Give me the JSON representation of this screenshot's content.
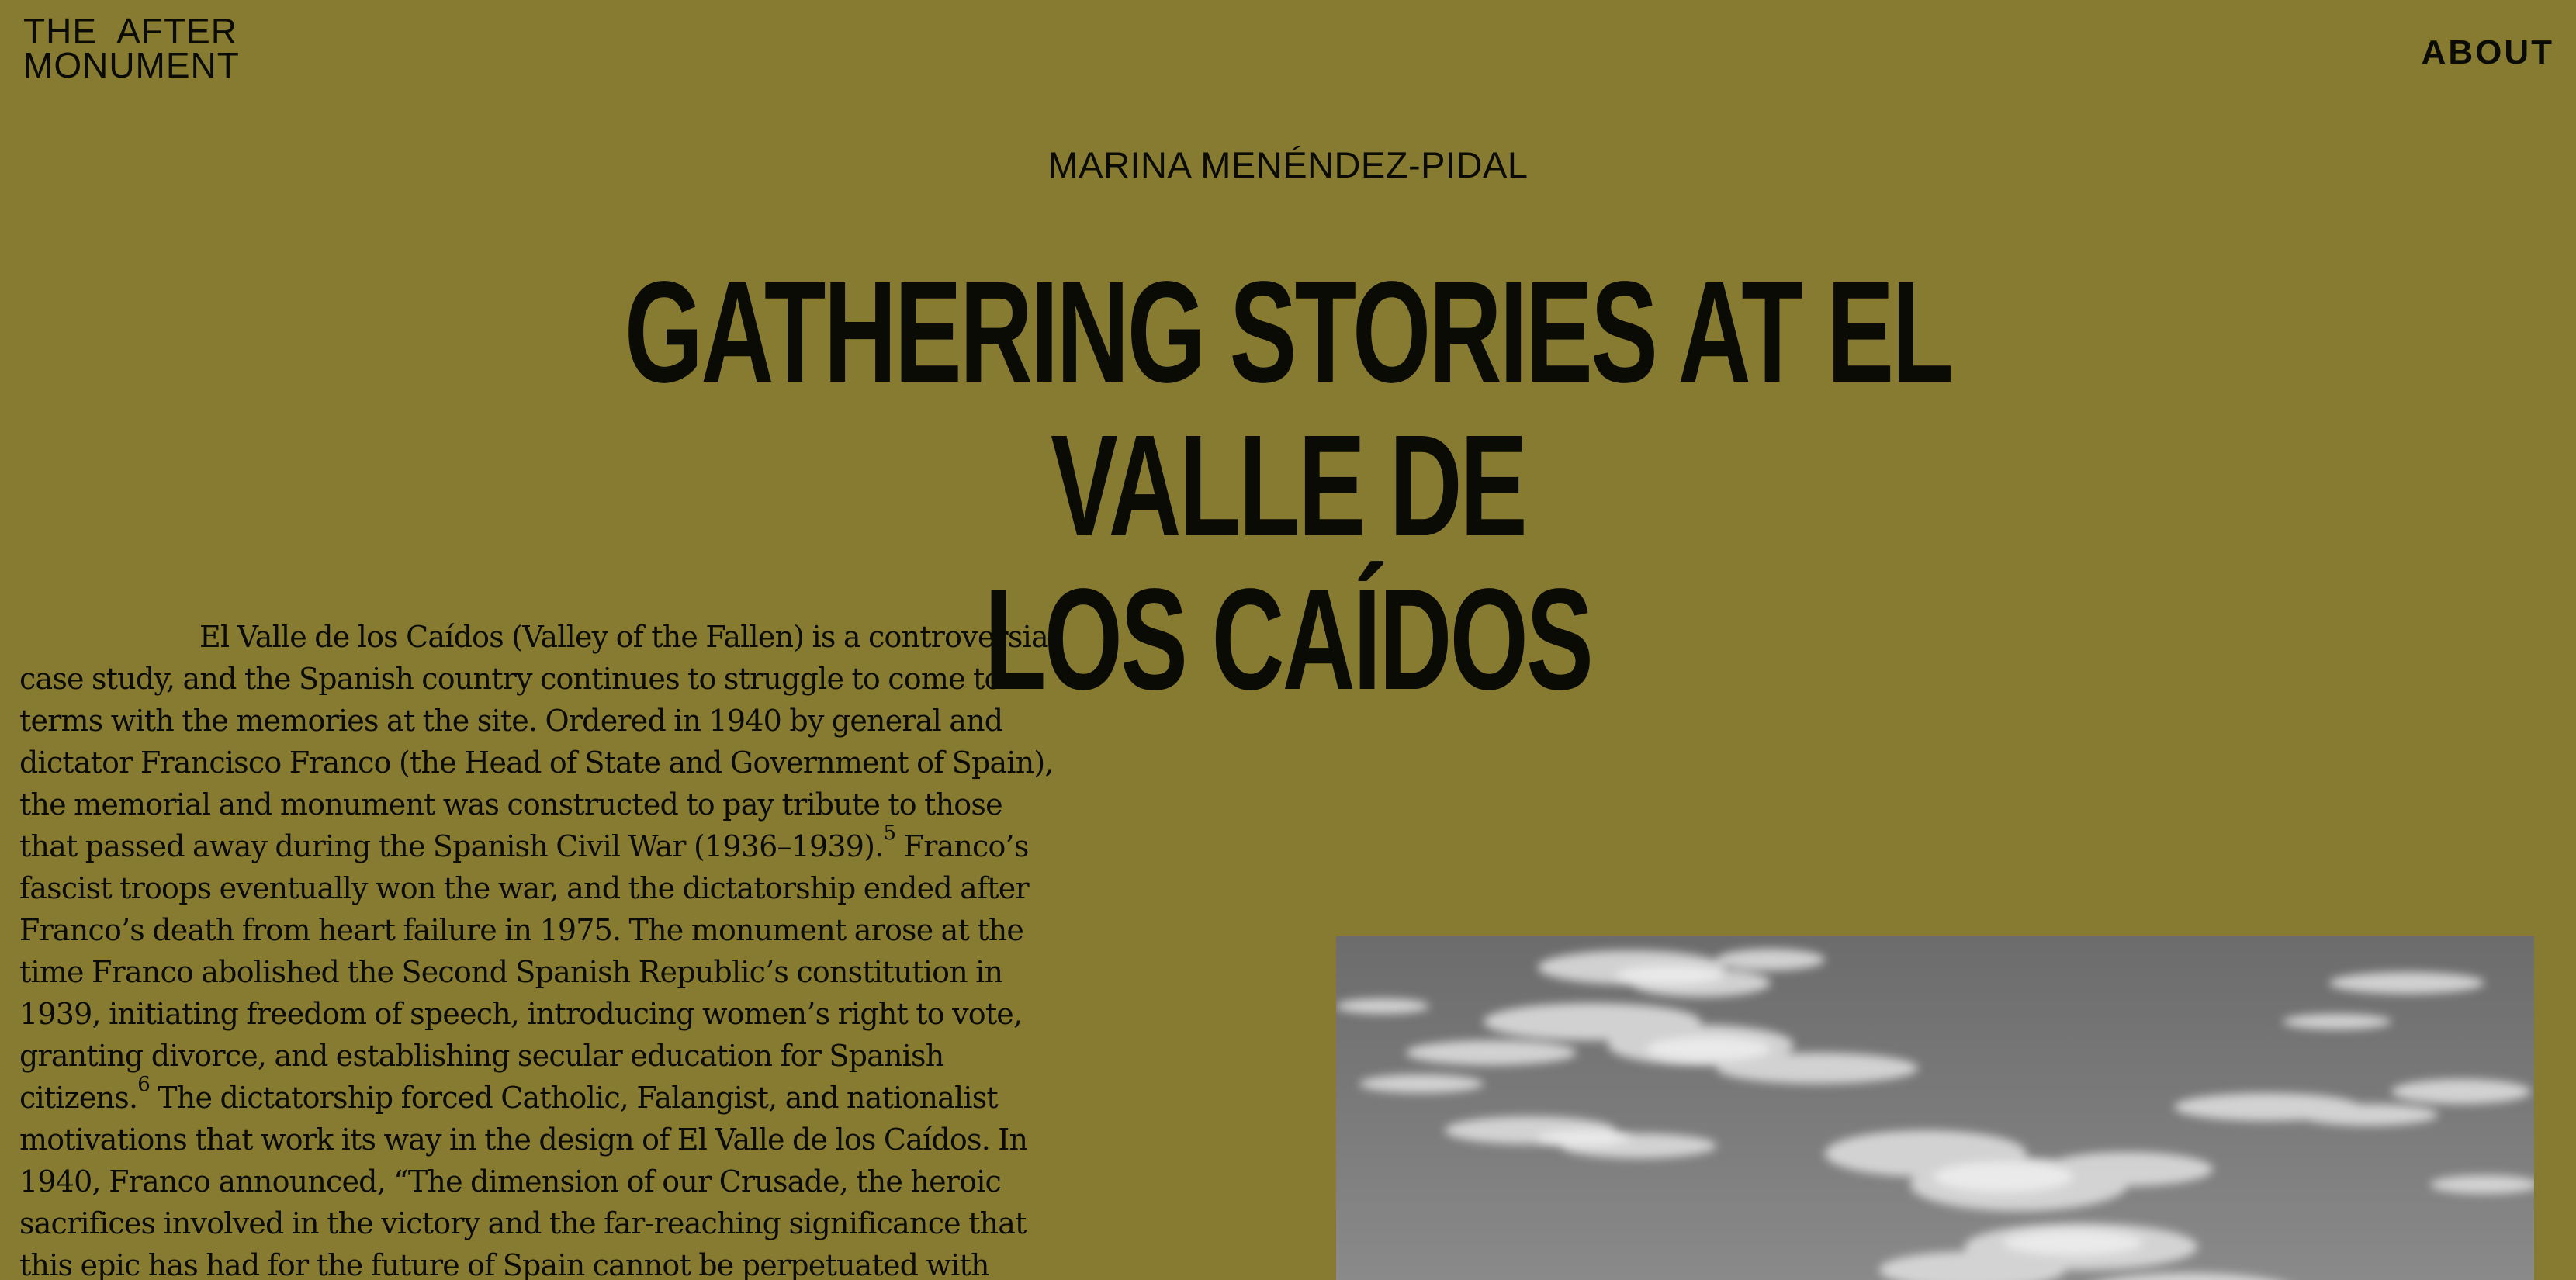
{
  "site": {
    "logo_line1": "THE  AFTER",
    "logo_line2": "MONUMENT",
    "nav_about": "ABOUT"
  },
  "article": {
    "author": "MARINA MENÉNDEZ-PIDAL",
    "title_line1": "GATHERING STORIES AT EL VALLE DE",
    "title_line2": "LOS CAÍDOS",
    "paragraph_1a": "El Valle de los Caídos (Valley of the Fallen) is a controversial case study, and the Spanish country continues to struggle to come to terms with the memories at the site. Ordered in 1940 by general and dictator Francisco Franco (the Head of State and Government of Spain), the memorial and monument was constructed to pay tribute to those that passed away during the Spanish Civil War (1936–1939).",
    "footnote_1": "5",
    "paragraph_1b": " Franco’s fascist troops eventually won the war, and the dictatorship ended after Franco’s death from heart failure in 1975. The monument arose at the time Franco abolished the Second Spanish Republic’s constitution in 1939, initiating freedom of speech, introducing women’s right to vote, granting divorce, and establishing secular education for Spanish citizens.",
    "footnote_2": "6",
    "paragraph_1c": " The dictatorship forced Catholic, Falangist, and nationalist motivations that work its way in the design of El Valle de los Caídos. In 1940, Franco announced, “The dimension of our Crusade, the heroic sacrifices involved in the victory and the far-reaching significance that this epic has had for the future of Spain cannot be perpetuated with"
  },
  "colors": {
    "background": "#877b31",
    "text": "#0b0b06",
    "photo_sky": "#7a7a7a",
    "photo_cloud": "#e6e6e6"
  }
}
